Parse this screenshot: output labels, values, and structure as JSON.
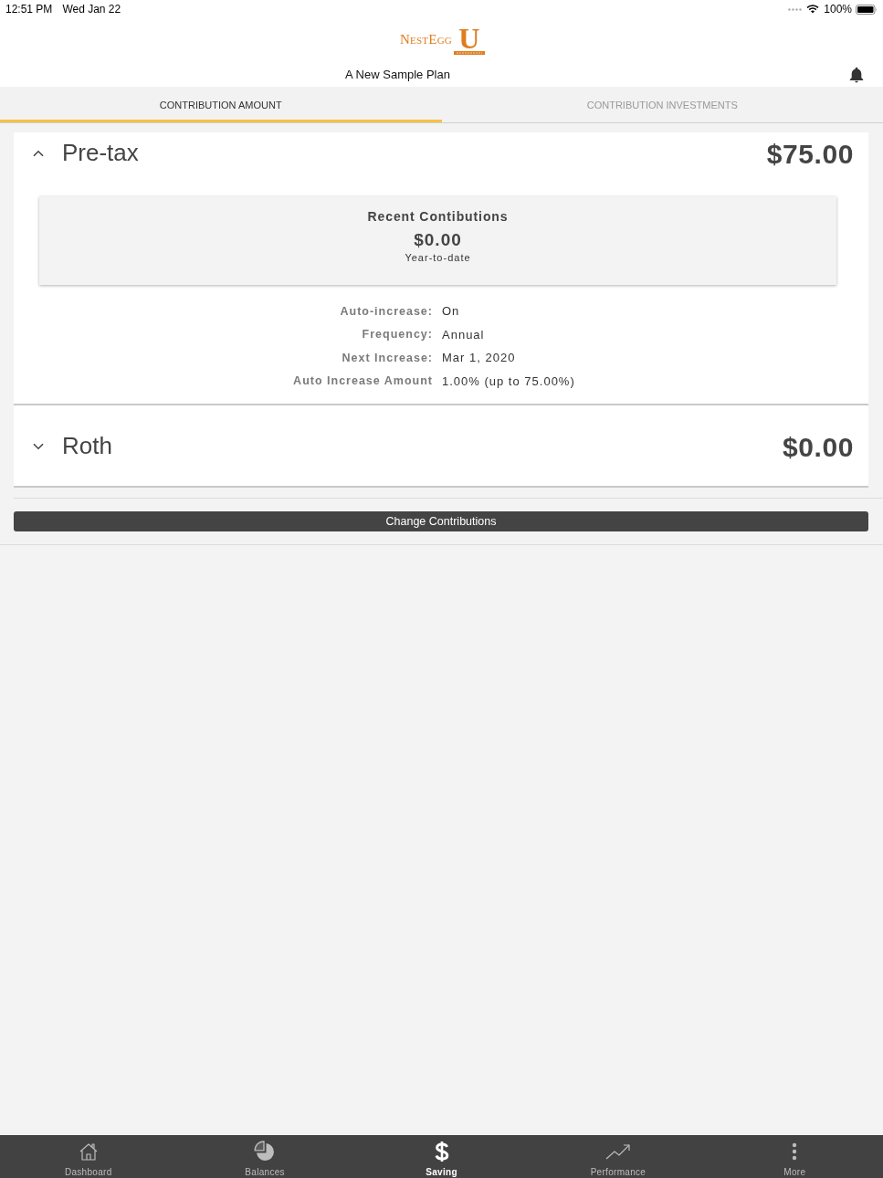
{
  "status_bar": {
    "time": "12:51 PM",
    "date": "Wed Jan 22",
    "battery": "100%"
  },
  "header": {
    "brand": "NestEgg",
    "brand_mark": "U",
    "plan_name": "A New Sample Plan"
  },
  "tabs": [
    {
      "label": "CONTRIBUTION AMOUNT",
      "selected": true
    },
    {
      "label": "CONTRIBUTION INVESTMENTS",
      "selected": false
    }
  ],
  "sections": [
    {
      "title": "Pre-tax",
      "amount": "$75.00",
      "expanded": true,
      "recent": {
        "title": "Recent Contibutions",
        "amount": "$0.00",
        "caption": "Year-to-date"
      },
      "details": [
        {
          "label": "Auto-increase:",
          "value": "On"
        },
        {
          "label": "Frequency:",
          "value": "Annual"
        },
        {
          "label": "Next Increase:",
          "value": "Mar 1, 2020"
        },
        {
          "label": "Auto Increase Amount",
          "value": "1.00% (up to 75.00%)"
        }
      ]
    },
    {
      "title": "Roth",
      "amount": "$0.00",
      "expanded": false
    }
  ],
  "action_button": {
    "label": "Change Contributions"
  },
  "bottom_nav": [
    {
      "label": "Dashboard",
      "selected": false
    },
    {
      "label": "Balances",
      "selected": false
    },
    {
      "label": "Saving",
      "selected": true
    },
    {
      "label": "Performance",
      "selected": false
    },
    {
      "label": "More",
      "selected": false
    }
  ]
}
